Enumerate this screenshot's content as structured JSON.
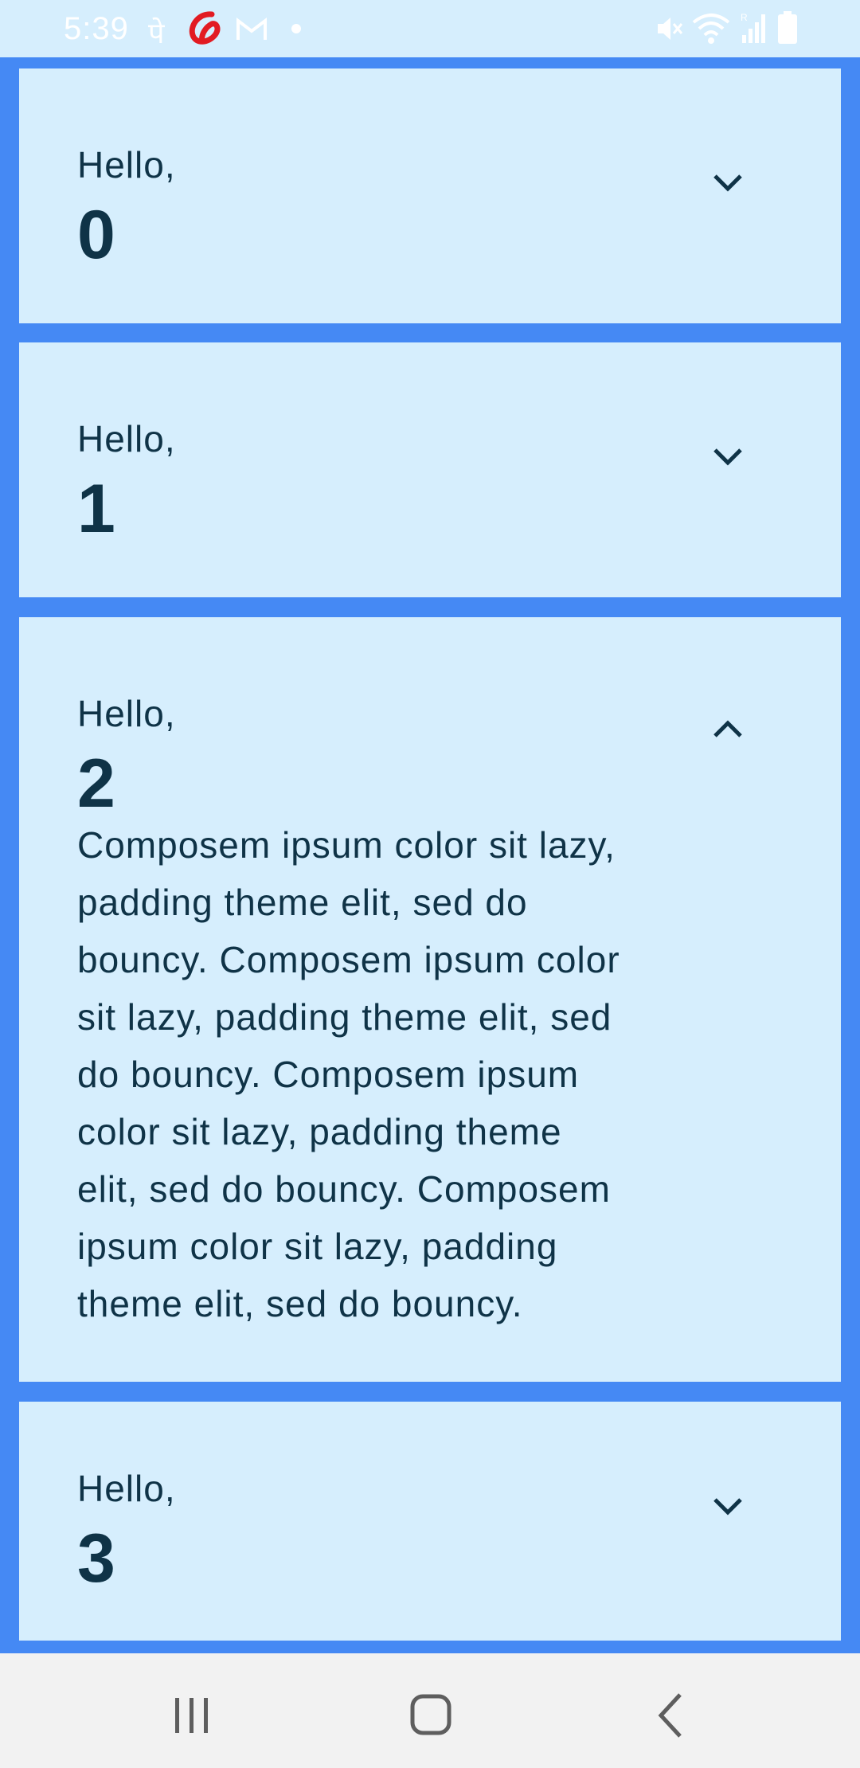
{
  "status_bar": {
    "time": "5:39",
    "icons": [
      "phonepe-icon",
      "airtel-icon",
      "gmail-icon",
      "notification-dot-icon",
      "mute-icon",
      "wifi-icon",
      "signal-icon",
      "battery-icon"
    ]
  },
  "colors": {
    "background": "#4589F4",
    "card": "#D6EEFD",
    "text": "#0F3347",
    "nav_bar": "#F2F2F2"
  },
  "cards": [
    {
      "greeting": "Hello,",
      "number": "0",
      "expanded": false,
      "chevron": "chevron-down-icon"
    },
    {
      "greeting": "Hello,",
      "number": "1",
      "expanded": false,
      "chevron": "chevron-down-icon"
    },
    {
      "greeting": "Hello,",
      "number": "2",
      "expanded": true,
      "chevron": "chevron-up-icon",
      "body_lines": [
        "Composem ipsum color sit lazy,",
        "padding theme elit, sed do",
        "bouncy. Composem ipsum color",
        "sit lazy, padding theme elit, sed",
        "do bouncy. Composem ipsum",
        "color sit lazy, padding theme",
        "elit, sed do bouncy. Composem",
        "ipsum color sit lazy, padding",
        "theme elit, sed do bouncy."
      ]
    },
    {
      "greeting": "Hello,",
      "number": "3",
      "expanded": false,
      "chevron": "chevron-down-icon"
    }
  ],
  "nav_bar": {
    "buttons": [
      "recent-apps-icon",
      "home-icon",
      "back-icon"
    ]
  }
}
